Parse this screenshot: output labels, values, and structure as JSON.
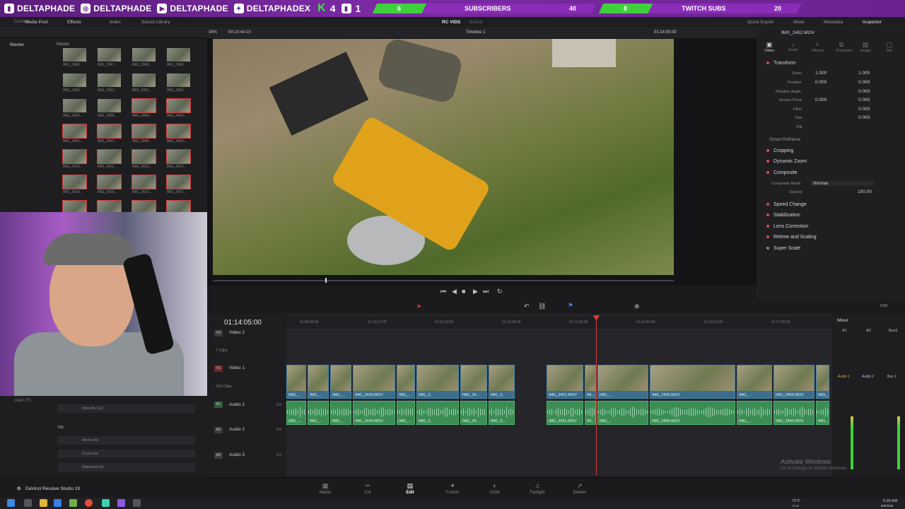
{
  "banner": {
    "handles": [
      {
        "icon": "twitch-icon",
        "name": "DELTAPHADE"
      },
      {
        "icon": "instagram-icon",
        "name": "DELTAPHADE"
      },
      {
        "icon": "youtube-icon",
        "name": "DELTAPHADE"
      },
      {
        "icon": "twitter-icon",
        "name": "DELTAPHADEX"
      }
    ],
    "kick_count": "4",
    "twitch_count": "1",
    "subs_current": "6",
    "subs_label": "SUBSCRIBERS",
    "subs_goal": "40",
    "twitch_subs_current": "8",
    "twitch_subs_label": "TWITCH SUBS",
    "twitch_subs_goal": "20"
  },
  "menubar": {
    "app_title": "DaVinci"
  },
  "toolbar": {
    "media_pool": "Media Pool",
    "effects": "Effects",
    "index": "Index",
    "sound_library": "Sound Library",
    "project": "RC VIDS",
    "project_state": "Edited",
    "quick_export": "Quick Export",
    "mixer": "Mixer",
    "metadata": "Metadata",
    "inspector": "Inspector"
  },
  "mediapool": {
    "root": "Master",
    "bin": "Master",
    "thumbs": [
      "IMG_2348...",
      "IMG_2347...",
      "IMG_2348...",
      "IMG_2349...",
      "IMG_2350...",
      "IMG_2351...",
      "IMG_2352...",
      "IMG_2353...",
      "IMG_2354...",
      "IMG_2355...",
      "IMG_2404...",
      "IMG_2405...",
      "IMG_2406...",
      "IMG_2407...",
      "IMG_2408...",
      "IMG_2409...",
      "IMG_2410...",
      "IMG_2411...",
      "IMG_2412...",
      "IMG_2413...",
      "IMG_2414...",
      "IMG_2415...",
      "IMG_2416...",
      "IMG_2417...",
      "IMG_2418...",
      "IMG_2419...",
      "IMG_2420...",
      "IMG_2421..."
    ]
  },
  "effects": {
    "open_fx": "Open FX",
    "smooth_cut": "Smooth Cut",
    "iris_header": "Iris",
    "iris_items": [
      "Arrow Iris",
      "Cross Iris",
      "Diamond Iris"
    ]
  },
  "viewer": {
    "zoom": "34%",
    "timecode_left": "00:14:44:10",
    "timeline_name": "Timeline 1",
    "timecode_right": "01:14:05:00"
  },
  "inspector": {
    "clip_name": "IMG_2452.MOV",
    "tabs": [
      "Video",
      "Audio",
      "Effects",
      "Transition",
      "Image",
      "File"
    ],
    "transform": "Transform",
    "zoom_label": "Zoom",
    "zoom_x": "1.000",
    "zoom_y": "1.000",
    "position_label": "Position",
    "pos_x": "0.000",
    "pos_y": "0.000",
    "rotation_label": "Rotation Angle",
    "rotation": "0.000",
    "anchor_label": "Anchor Point",
    "anchor_x": "0.000",
    "anchor_y": "0.000",
    "pitch_label": "Pitch",
    "pitch": "0.000",
    "yaw_label": "Yaw",
    "yaw": "0.000",
    "flip_label": "Flip",
    "smart_reframe": "Smart Reframe",
    "cropping": "Cropping",
    "dynamic_zoom": "Dynamic Zoom",
    "composite": "Composite",
    "composite_mode_label": "Composite Mode",
    "composite_mode": "Normal",
    "opacity_label": "Opacity",
    "opacity": "100.00",
    "speed_change": "Speed Change",
    "stabilization": "Stabilization",
    "lens_correction": "Lens Correction",
    "retime": "Retime and Scaling",
    "super_scale": "Super Scale"
  },
  "timeline": {
    "timecode": "01:14:05:00",
    "ruler": [
      "01:09:04:00",
      "01:10:12:00",
      "01:11:20:00",
      "01:12:28:00",
      "01:13:36:00",
      "01:14:44:00",
      "01:15:52:00",
      "01:17:00:00"
    ],
    "v2": {
      "id": "V2",
      "name": "Video 2",
      "count": "7 Clips"
    },
    "v1": {
      "id": "V1",
      "name": "Video 1",
      "count": "103 Clips"
    },
    "a1": {
      "id": "A1",
      "name": "Audio 1",
      "level": "2.0"
    },
    "a2": {
      "id": "A2",
      "name": "Audio 2",
      "level": "2.0"
    },
    "a3": {
      "id": "A3",
      "name": "Audio 3",
      "level": "2.0"
    },
    "vclips": [
      {
        "name": "IMG_..."
      },
      {
        "name": "IMG_..."
      },
      {
        "name": "IMG_..."
      },
      {
        "name": "IMG_2443.MOV"
      },
      {
        "name": "IMG_..."
      },
      {
        "name": "IMG_2..."
      },
      {
        "name": "IMG_24..."
      },
      {
        "name": "IMG_2..."
      },
      {
        "name": "IMG_2451.MOV"
      },
      {
        "name": "IM..."
      },
      {
        "name": "IMG_..."
      },
      {
        "name": "IMG_2455.MOV"
      },
      {
        "name": "IMG_..."
      },
      {
        "name": "IMG_2460.MOV"
      },
      {
        "name": "IMG_..."
      }
    ],
    "aclips": [
      {
        "name": "IMG_..."
      },
      {
        "name": "IMG_..."
      },
      {
        "name": "IMG_..."
      },
      {
        "name": "IMG_2443.MOV"
      },
      {
        "name": "IMG_..."
      },
      {
        "name": "IMG_2..."
      },
      {
        "name": "IMG_24..."
      },
      {
        "name": "IMG_2..."
      },
      {
        "name": "IMG_2451.MOV"
      },
      {
        "name": "IM..."
      },
      {
        "name": "IMG_..."
      },
      {
        "name": "IMG_2455.MOV"
      },
      {
        "name": "IMG_..."
      },
      {
        "name": "IMG_2460.MOV"
      },
      {
        "name": "IMG_..."
      }
    ]
  },
  "mixer": {
    "title": "Mixer",
    "ch": [
      "A1",
      "A2",
      "Bus1"
    ],
    "dim": "DIM",
    "a_labels": [
      "Audio 1",
      "Audio 2",
      "Bus 1"
    ]
  },
  "pages": [
    "Media",
    "Cut",
    "Edit",
    "Fusion",
    "Color",
    "Fairlight",
    "Deliver"
  ],
  "active_page": "Edit",
  "brand": "DaVinci Resolve Studio 19",
  "watermark": {
    "line1": "Activate Windows",
    "line2": "Go to Settings to activate Windows."
  },
  "tray": {
    "weather": "71°F",
    "weather_sub": "Clear",
    "time": "5:39 AM",
    "date": "8/9/2025"
  }
}
